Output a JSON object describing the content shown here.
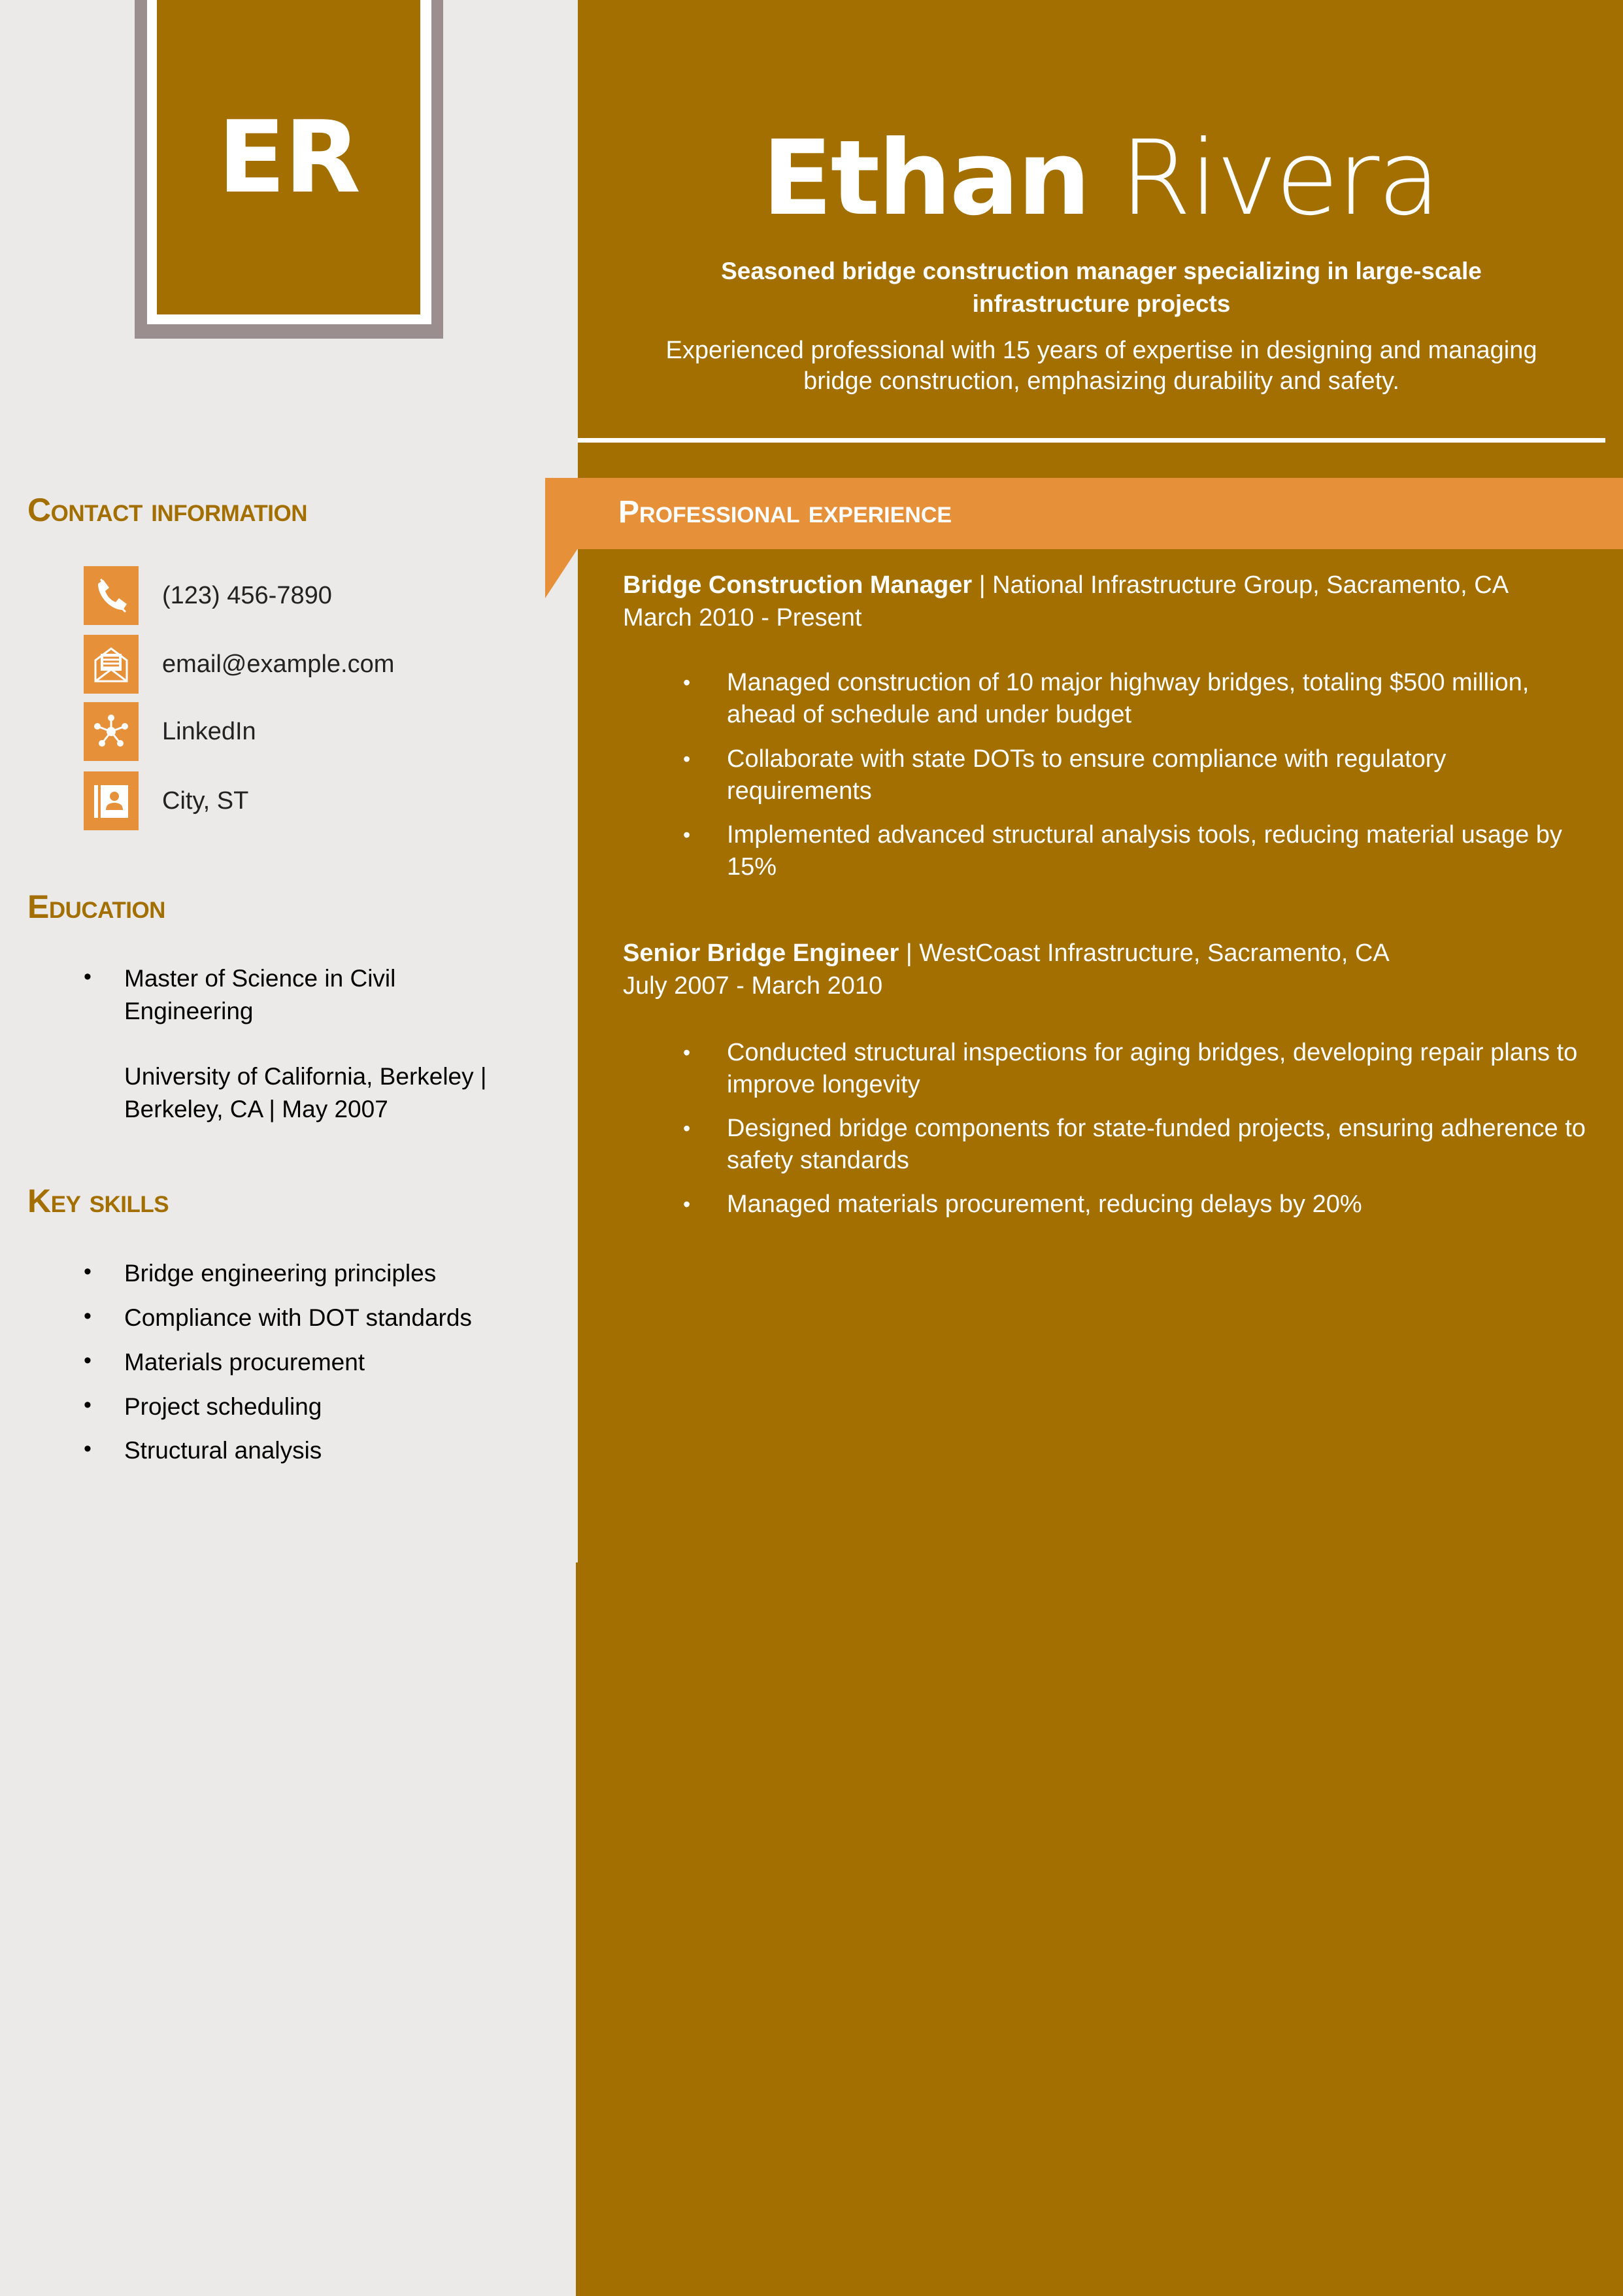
{
  "monogram": "ER",
  "header": {
    "first_name": "Ethan",
    "last_name": "Rivera",
    "tagline_line1": "Seasoned bridge construction manager specializing in large-scale",
    "tagline_line2": "infrastructure projects",
    "summary_line1": "Experienced professional with 15 years of expertise in designing and managing",
    "summary_line2": "bridge construction, emphasizing durability and safety."
  },
  "colors": {
    "gold": "#a26f00",
    "orange": "#e6903a",
    "panel_bg": "#ebeae8",
    "frame_gray": "#9a8f8e"
  },
  "contact": {
    "heading": "Contact information",
    "items": [
      {
        "icon": "phone-icon",
        "text": "(123) 456-7890"
      },
      {
        "icon": "email-icon",
        "text": "email@example.com"
      },
      {
        "icon": "network-icon",
        "text": "LinkedIn"
      },
      {
        "icon": "address-book-icon",
        "text": "City, ST"
      }
    ]
  },
  "education": {
    "heading": "Education",
    "degree_line1": "Master of Science in Civil",
    "degree_line2": "Engineering",
    "school_line1": "University of California, Berkeley |",
    "school_line2": "Berkeley, CA | May 2007"
  },
  "skills": {
    "heading": "Key skills",
    "items": [
      "Bridge engineering principles",
      "Compliance with DOT standards",
      "Materials procurement",
      "Project scheduling",
      "Structural analysis"
    ]
  },
  "experience": {
    "heading": "Professional experience",
    "jobs": [
      {
        "title": "Bridge Construction Manager",
        "company": " | National Infrastructure Group, Sacramento, CA",
        "dates": "March 2010 - Present",
        "bullets": [
          [
            "Managed construction of 10 major highway bridges, totaling $500 million,",
            "ahead of schedule and under budget"
          ],
          [
            "Collaborate with state DOTs to ensure compliance with regulatory",
            "requirements"
          ],
          [
            "Implemented advanced structural analysis tools, reducing material usage by",
            "15%"
          ]
        ]
      },
      {
        "title": "Senior Bridge Engineer",
        "company": " | WestCoast Infrastructure, Sacramento, CA",
        "dates": "July 2007 - March 2010",
        "bullets": [
          [
            "Conducted structural inspections for aging bridges, developing repair plans to",
            "improve longevity"
          ],
          [
            "Designed bridge components for state-funded projects, ensuring adherence to",
            "safety standards"
          ],
          [
            "Managed materials procurement, reducing delays by 20%",
            ""
          ]
        ]
      }
    ]
  },
  "bullet_glyph": "•"
}
